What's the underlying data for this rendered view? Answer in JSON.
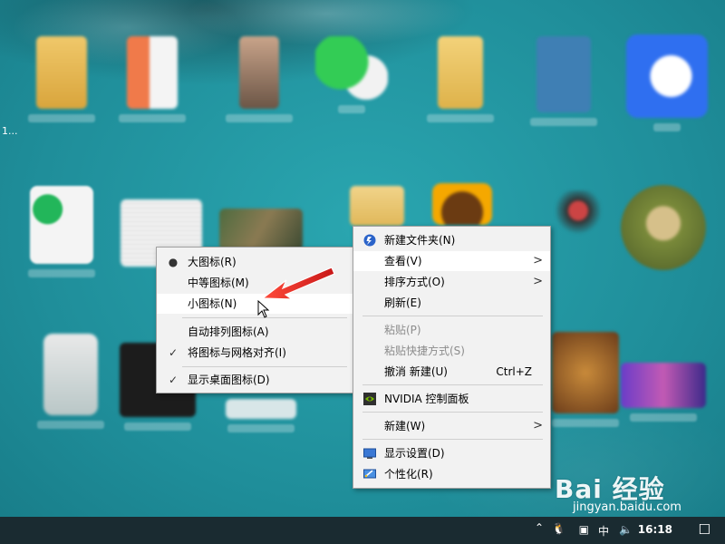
{
  "desktop_edge_text": "1...",
  "view_submenu": {
    "items": [
      {
        "label": "大图标(R)",
        "mark": "dot"
      },
      {
        "label": "中等图标(M)",
        "mark": ""
      },
      {
        "label": "小图标(N)",
        "mark": "",
        "highlighted": true
      },
      {
        "label": "自动排列图标(A)",
        "mark": ""
      },
      {
        "label": "将图标与网格对齐(I)",
        "mark": "check"
      },
      {
        "label": "显示桌面图标(D)",
        "mark": "check"
      }
    ]
  },
  "context_menu": {
    "items": [
      {
        "label": "新建文件夹(N)",
        "icon": "new-folder-icon"
      },
      {
        "label": "查看(V)",
        "submenu": true,
        "highlighted": true
      },
      {
        "label": "排序方式(O)",
        "submenu": true
      },
      {
        "label": "刷新(E)"
      },
      {
        "label": "粘贴(P)",
        "disabled": true
      },
      {
        "label": "粘贴快捷方式(S)",
        "disabled": true
      },
      {
        "label": "撤消 新建(U)",
        "shortcut": "Ctrl+Z"
      },
      {
        "label": "NVIDIA 控制面板",
        "icon": "nvidia-icon"
      },
      {
        "label": "新建(W)",
        "submenu": true
      },
      {
        "label": "显示设置(D)",
        "icon": "display-icon"
      },
      {
        "label": "个性化(R)",
        "icon": "personalize-icon"
      }
    ]
  },
  "taskbar": {
    "time": "16:18",
    "ime": "中"
  },
  "watermark": {
    "brand": "Bai 经验",
    "url": "jingyan.baidu.com"
  },
  "colors": {
    "menu_bg": "#f2f2f2",
    "annotation_arrow": "#e02020",
    "taskbar": "#1a2b31"
  }
}
